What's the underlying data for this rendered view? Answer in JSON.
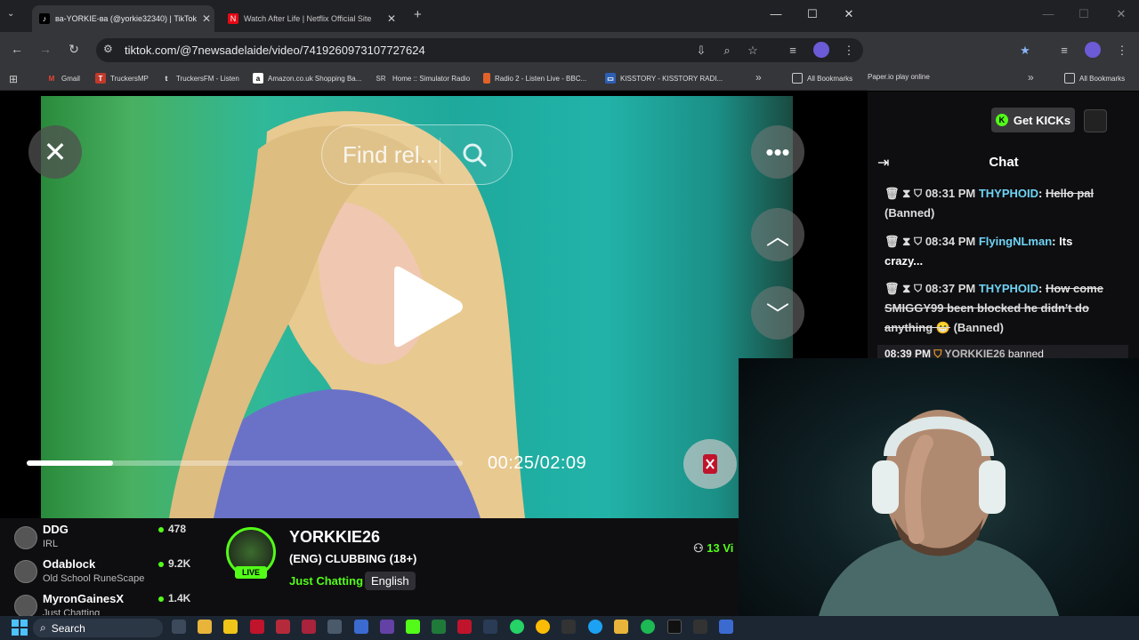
{
  "browser": {
    "tabs": [
      {
        "title": "ва-YORKIE-ва (@yorkie32340) | TikTok",
        "icon": "tiktok-icon",
        "active": true
      },
      {
        "title": "Watch After Life | Netflix Official Site",
        "icon": "netflix-icon",
        "active": false
      }
    ],
    "url": "tiktok.com/@7newsadelaide/video/7419260973107727624",
    "bookmarks": [
      {
        "label": "Gmail",
        "icon": "gmail-icon"
      },
      {
        "label": "TruckersMP",
        "icon": "truckersmp-icon"
      },
      {
        "label": "TruckersFM - Listen",
        "icon": "truckersfm-icon"
      },
      {
        "label": "Amazon.co.uk Shopping Ba...",
        "icon": "amazon-icon"
      },
      {
        "label": "Home :: Simulator Radio",
        "icon": "simulator-radio-icon"
      },
      {
        "label": "Radio 2 - Listen Live - BBC...",
        "icon": "bbc-icon"
      },
      {
        "label": "KISSTORY - KISSTORY RADI...",
        "icon": "kisstory-icon"
      }
    ],
    "all_bookmarks": "All Bookmarks",
    "second_window": {
      "bookmark_item": "Paper.io play online",
      "all_bookmarks": "All Bookmarks"
    }
  },
  "video": {
    "search_placeholder": "Find rel...",
    "time": "00:25/02:09",
    "progress": 0.197
  },
  "chat": {
    "get_kicks": "Get KICKs",
    "title": "Chat",
    "messages": [
      {
        "time": "08:31 PM",
        "user": "THYPHOID",
        "text": "Hello pal",
        "status": "(Banned)",
        "struck": true
      },
      {
        "time": "08:34 PM",
        "user": "FlyingNLman",
        "text": "Its crazy...",
        "status": "",
        "struck": false
      },
      {
        "time": "08:37 PM",
        "user": "THYPHOID",
        "text": "How come SMIGGY99 been blocked he didn't do anything 😁",
        "status": "(Banned)",
        "struck": true
      }
    ],
    "ban_notice": {
      "time": "08:39 PM",
      "user": "YORKKIE26",
      "action": "banned"
    }
  },
  "recommended": [
    {
      "name": "DDG",
      "category": "IRL",
      "viewers": "478"
    },
    {
      "name": "Odablock",
      "category": "Old School RuneScape",
      "viewers": "9.2K"
    },
    {
      "name": "MyronGainesX",
      "category": "Just Chatting",
      "viewers": "1.4K"
    }
  ],
  "channel": {
    "name": "YORKKIE26",
    "live": "LIVE",
    "title": "(ENG) CLUBBING (18+)",
    "category": "Just Chatting",
    "language": "English",
    "viewers": "13 Vi"
  },
  "taskbar": {
    "search": "Search"
  },
  "colors": {
    "kick_green": "#53fc18",
    "chat_user": "#6fd3f5",
    "browser_frame": "#202124",
    "toolbar": "#35363a"
  }
}
